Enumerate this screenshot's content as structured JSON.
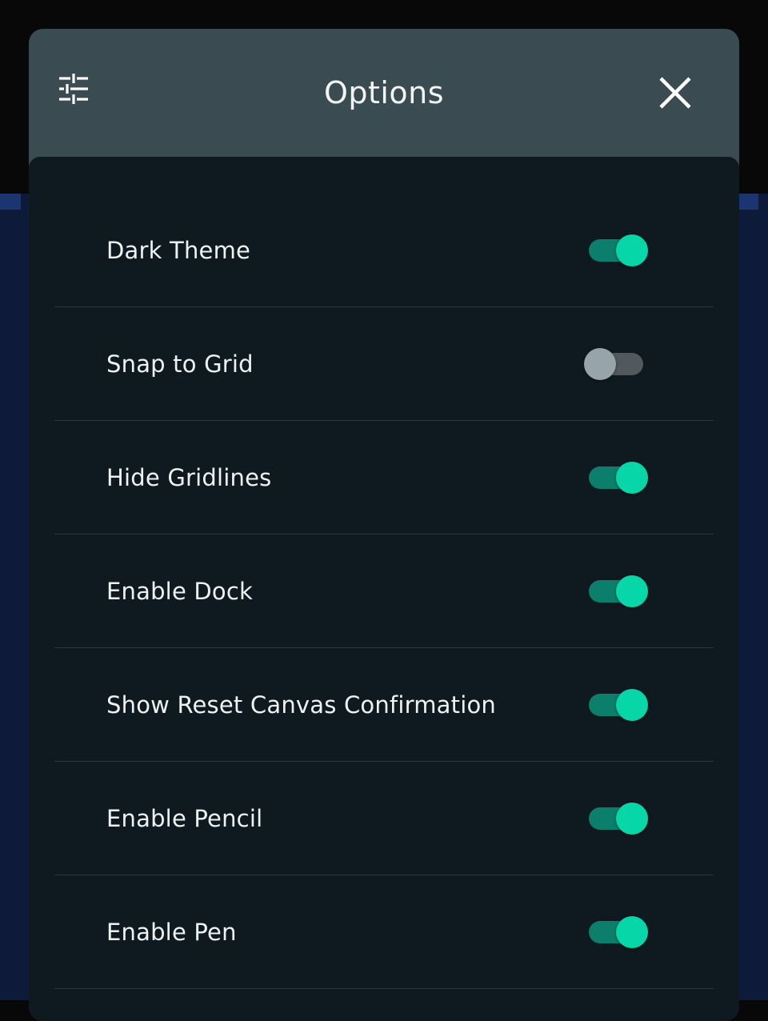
{
  "colors": {
    "header_bg": "#3a4b51",
    "body_bg": "#0e1a20",
    "accent_on": "#06d6a8",
    "track_on": "#0b7f6b",
    "knob_off": "#97a4aa",
    "track_off": "#51595c"
  },
  "header": {
    "icon": "sliders-icon",
    "title": "Options",
    "close_icon": "close-icon"
  },
  "settings": [
    {
      "label": "Dark Theme",
      "on": true
    },
    {
      "label": "Snap to Grid",
      "on": false
    },
    {
      "label": "Hide Gridlines",
      "on": true
    },
    {
      "label": "Enable Dock",
      "on": true
    },
    {
      "label": "Show Reset Canvas Confirmation",
      "on": true
    },
    {
      "label": "Enable Pencil",
      "on": true
    },
    {
      "label": "Enable Pen",
      "on": true
    }
  ]
}
